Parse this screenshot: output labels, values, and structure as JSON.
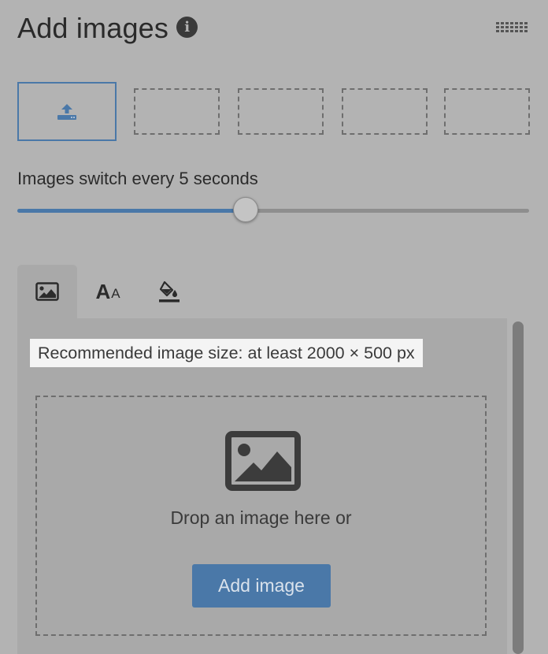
{
  "header": {
    "title": "Add images",
    "info_icon": "info-circle-icon",
    "grid_icon": "drag-grid-icon"
  },
  "slots": {
    "upload_icon": "upload-icon",
    "empty_count": 4
  },
  "slider": {
    "label": "Images switch every 5 seconds",
    "value_fraction": 0.446
  },
  "tabs": [
    {
      "name": "image",
      "icon": "image-icon",
      "active": true
    },
    {
      "name": "text",
      "big": "A",
      "small": "A"
    },
    {
      "name": "fill",
      "icon": "paint-bucket-icon"
    }
  ],
  "panel": {
    "recommendation": "Recommended image size: at least 2000 × 500 px",
    "dropzone": {
      "icon": "image-icon",
      "text": "Drop an image here or",
      "button_label": "Add image"
    }
  },
  "colors": {
    "accent": "#4a78a8",
    "background": "#b3b3b3",
    "panel": "#a9a9a9",
    "highlight": "#f4f4f4"
  }
}
